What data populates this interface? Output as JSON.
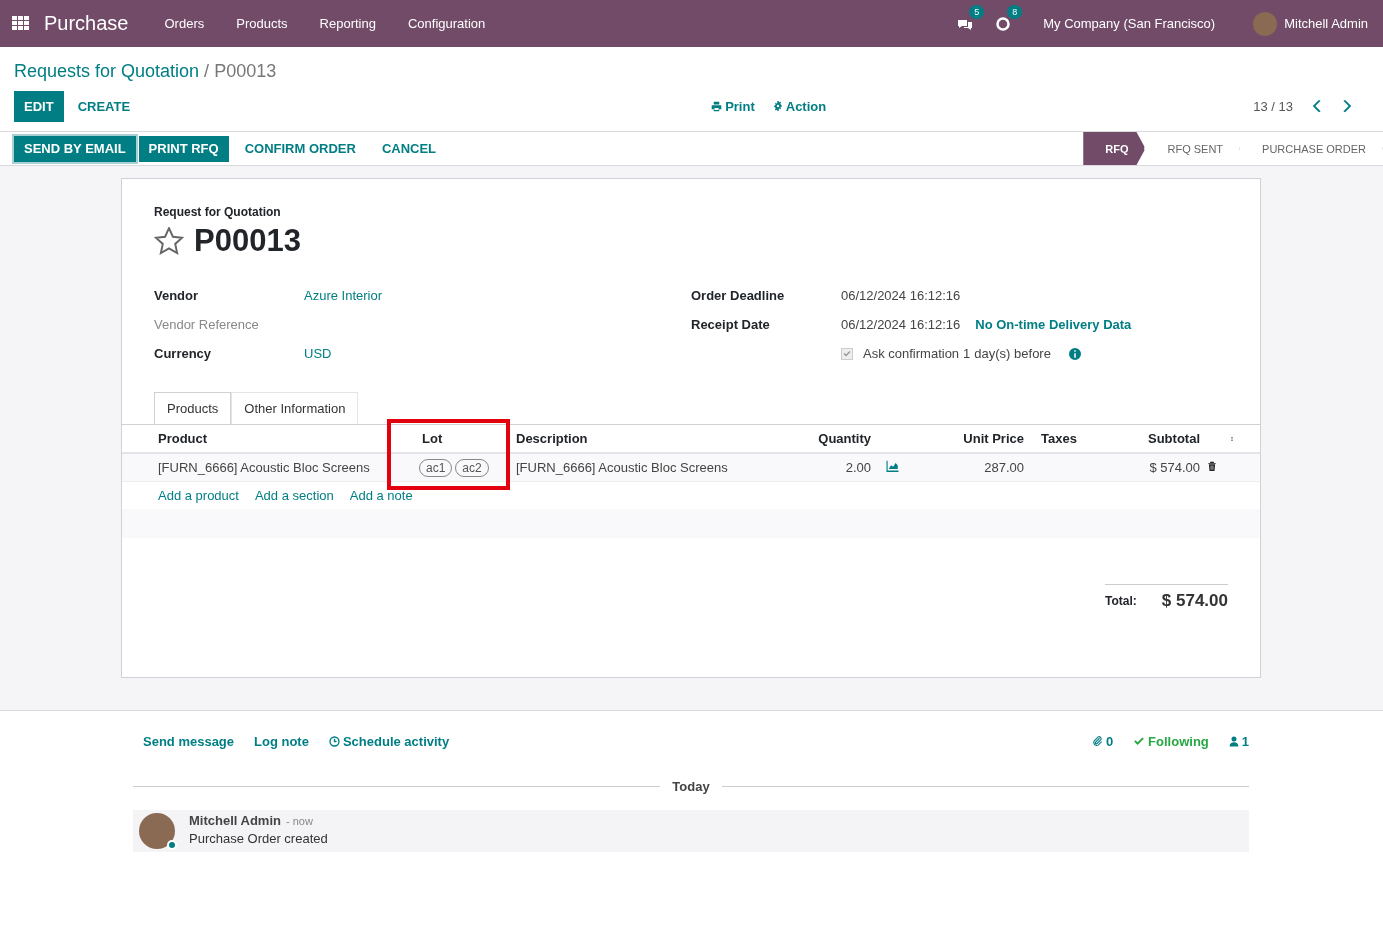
{
  "navbar": {
    "app_name": "Purchase",
    "menu": [
      "Orders",
      "Products",
      "Reporting",
      "Configuration"
    ],
    "messages_count": "5",
    "activities_count": "8",
    "company": "My Company (San Francisco)",
    "user": "Mitchell Admin"
  },
  "breadcrumb": {
    "parent": "Requests for Quotation",
    "separator": "/",
    "current": "P00013"
  },
  "control": {
    "buttons": [
      {
        "label": "EDIT",
        "kind": "primary"
      },
      {
        "label": "CREATE",
        "kind": "link"
      }
    ],
    "print": "Print",
    "action": "Action",
    "pager": "13 / 13"
  },
  "header_buttons": [
    {
      "label": "SEND BY EMAIL",
      "kind": "primary",
      "focused": true
    },
    {
      "label": "PRINT RFQ",
      "kind": "primary",
      "focused": false
    },
    {
      "label": "CONFIRM ORDER",
      "kind": "link",
      "focused": false
    },
    {
      "label": "CANCEL",
      "kind": "link",
      "focused": false
    }
  ],
  "stages": [
    {
      "label": "RFQ",
      "selected": true
    },
    {
      "label": "RFQ SENT",
      "selected": false
    },
    {
      "label": "PURCHASE ORDER",
      "selected": false
    }
  ],
  "form": {
    "title_label": "Request for Quotation",
    "name": "P00013",
    "starred": false,
    "left_fields": [
      {
        "label": "Vendor",
        "value": "Azure Interior",
        "muted": false
      },
      {
        "label": "Vendor Reference",
        "muted": true
      },
      {
        "label": "Currency",
        "value": "USD",
        "muted": false
      }
    ],
    "right_fields": [
      {
        "label": "Order Deadline",
        "value": "06/12/2024 16:12:16"
      },
      {
        "label": "Receipt Date",
        "value": "06/12/2024 16:12:16",
        "link": "No On-time Delivery Data"
      }
    ],
    "ask_confirmation": {
      "checked": true,
      "label": "Ask confirmation",
      "days": "1",
      "suffix": "day(s) before"
    }
  },
  "tabs": [
    {
      "label": "Products",
      "selected": true
    },
    {
      "label": "Other Information",
      "selected": false
    }
  ],
  "table": {
    "columns": [
      "Product",
      "Lot",
      "Description",
      "Quantity",
      "Unit Price",
      "Taxes",
      "Subtotal"
    ],
    "rows": [
      {
        "product": "[FURN_6666] Acoustic Bloc Screens",
        "lots": [
          "ac1",
          "ac2"
        ],
        "description": "[FURN_6666] Acoustic Bloc Screens",
        "quantity": "2.00",
        "unit_price": "287.00",
        "subtotal": "$ 574.00"
      }
    ],
    "add_links": [
      "Add a product",
      "Add a section",
      "Add a note"
    ]
  },
  "total": {
    "label": "Total:",
    "value": "$ 574.00"
  },
  "chatter": {
    "actions": [
      "Send message",
      "Log note",
      "Schedule activity"
    ],
    "attachments": "0",
    "following": "Following",
    "followers": "1",
    "separator": "Today",
    "messages": [
      {
        "author": "Mitchell Admin",
        "time": "- now",
        "body": "Purchase Order created",
        "online": true
      }
    ]
  }
}
